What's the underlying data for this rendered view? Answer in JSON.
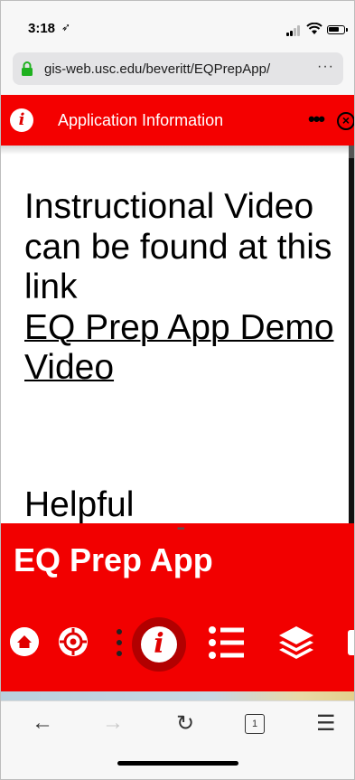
{
  "status_bar": {
    "time": "3:18",
    "location_glyph": "➶"
  },
  "browser": {
    "url": "gis-web.usc.edu/beveritt/EQPrepApp/",
    "more": "···"
  },
  "dialog": {
    "title": "Application Information",
    "more": "•••",
    "close": "×",
    "info_glyph": "i",
    "body_text": "Instructional Video can be found at this link",
    "link_text": "EQ Prep App Demo Video",
    "next_heading": "Helpful"
  },
  "app": {
    "title": "EQ Prep App",
    "grip": "•••",
    "info_glyph": "i",
    "accent_color": "#f20000"
  },
  "toolbar": {
    "back": "←",
    "forward": "→",
    "reload": "↻",
    "tabs_count": "1",
    "menu": "☰"
  },
  "icons": [
    "lock-icon",
    "info-icon",
    "close-icon",
    "home-icon",
    "locate-icon",
    "list-icon",
    "layers-icon"
  ]
}
